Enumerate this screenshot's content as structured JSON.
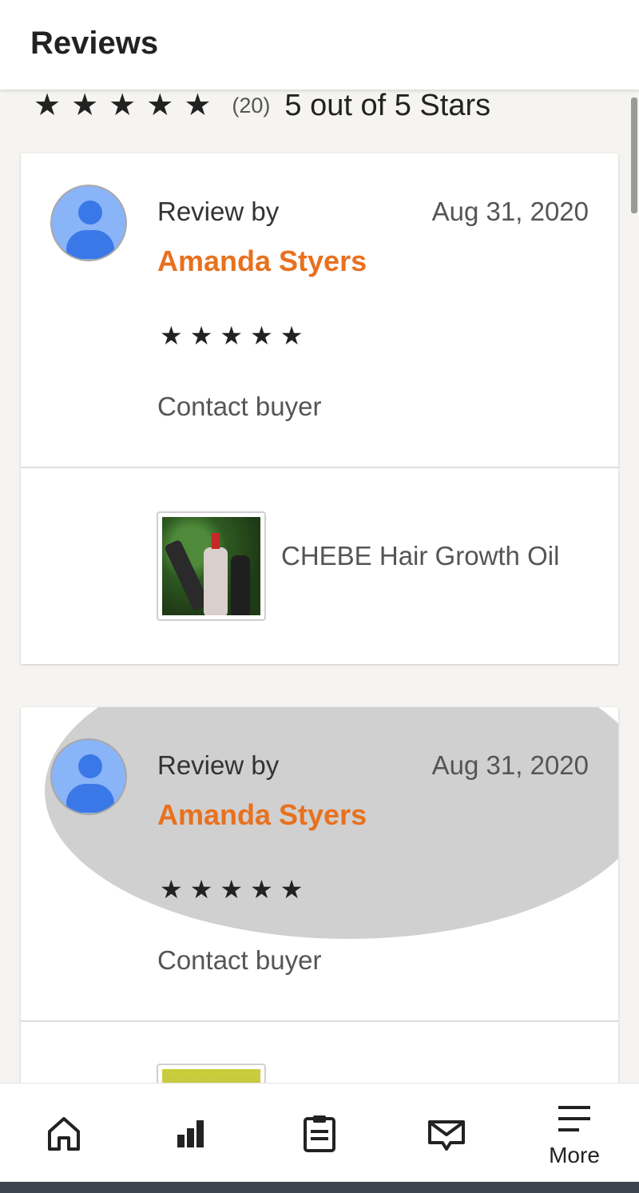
{
  "header": {
    "title": "Reviews"
  },
  "summary": {
    "stars": [
      "★",
      "★",
      "★",
      "★",
      "★"
    ],
    "count": "(20)",
    "text": "5 out of 5 Stars",
    "rating": 5
  },
  "reviews": [
    {
      "review_by_label": "Review by",
      "reviewer": "Amanda Styers",
      "date": "Aug 31, 2020",
      "stars": [
        "★",
        "★",
        "★",
        "★",
        "★"
      ],
      "contact_label": "Contact buyer",
      "product": "CHEBE Hair Growth Oil",
      "highlighted": false
    },
    {
      "review_by_label": "Review by",
      "reviewer": "Amanda Styers",
      "date": "Aug 31, 2020",
      "stars": [
        "★",
        "★",
        "★",
        "★",
        "★"
      ],
      "contact_label": "Contact buyer",
      "highlighted": true
    }
  ],
  "tabbar": {
    "items": [
      {
        "icon": "home-icon",
        "label": ""
      },
      {
        "icon": "stats-icon",
        "label": ""
      },
      {
        "icon": "orders-icon",
        "label": ""
      },
      {
        "icon": "messages-icon",
        "label": ""
      },
      {
        "icon": "menu-icon",
        "label": "More"
      }
    ]
  },
  "colors": {
    "reviewer_name": "#e8711f",
    "highlight": "#d0d0d0",
    "avatar": "#3b78e7"
  }
}
